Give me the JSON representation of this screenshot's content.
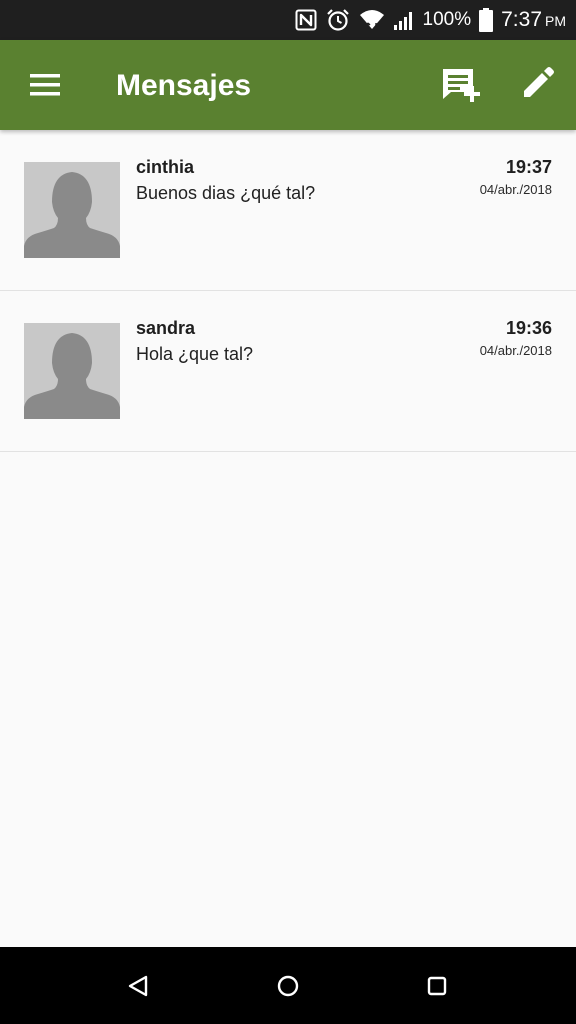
{
  "status_bar": {
    "icons": [
      "nfc-icon",
      "alarm-icon",
      "wifi-icon",
      "signal-icon",
      "battery-icon"
    ],
    "battery": "100%",
    "time": "7:37",
    "ampm": "PM"
  },
  "app_bar": {
    "title": "Mensajes",
    "background_color": "#5a8130",
    "icons": {
      "menu": "menu-icon",
      "new_message": "new-message-icon",
      "compose": "pencil-icon"
    }
  },
  "conversations": [
    {
      "name": "cinthia",
      "snippet": "Buenos dias ¿qué tal?",
      "time": "19:37",
      "date": "04/abr./2018"
    },
    {
      "name": "sandra",
      "snippet": "Hola ¿que tal?",
      "time": "19:36",
      "date": "04/abr./2018"
    }
  ],
  "nav_bar": {
    "icons": [
      "back-icon",
      "home-icon",
      "recents-icon"
    ]
  }
}
